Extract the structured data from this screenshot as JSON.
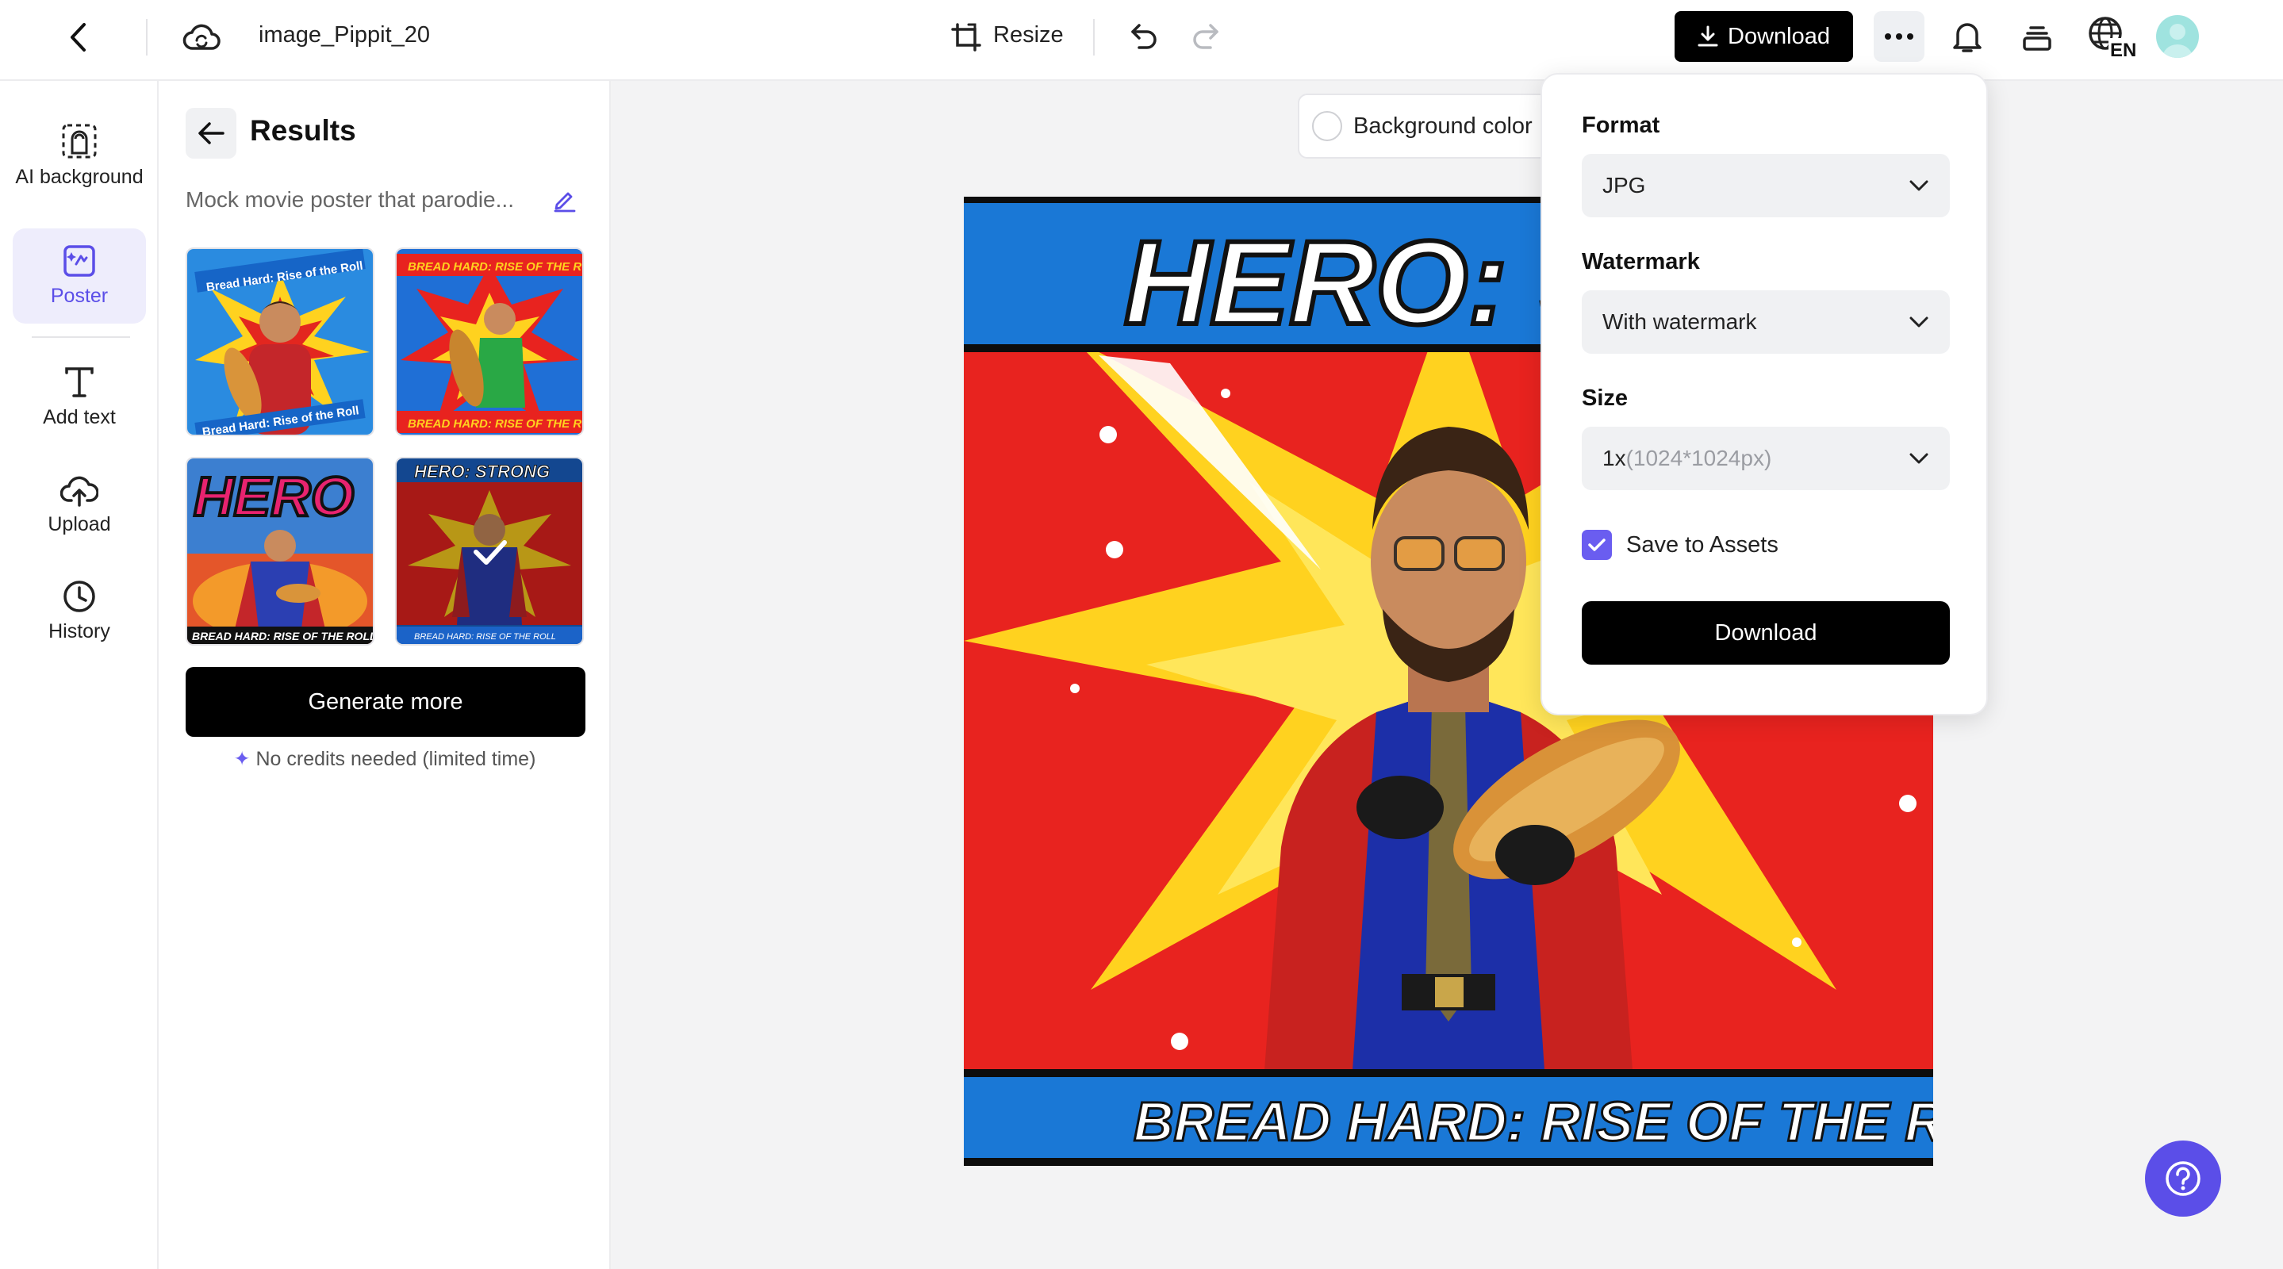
{
  "header": {
    "project_title": "image_Pippit_20",
    "resize_label": "Resize",
    "download_label": "Download",
    "language_label": "EN"
  },
  "sidebar": {
    "items": [
      {
        "label": "AI background",
        "icon": "ai-background-icon",
        "active": false
      },
      {
        "label": "Poster",
        "icon": "poster-icon",
        "active": true
      },
      {
        "label": "Add text",
        "icon": "text-icon",
        "active": false
      },
      {
        "label": "Upload",
        "icon": "upload-icon",
        "active": false
      },
      {
        "label": "History",
        "icon": "history-icon",
        "active": false
      }
    ]
  },
  "results_panel": {
    "title": "Results",
    "prompt_preview": "Mock movie poster that parodie...",
    "thumbnails": [
      {
        "caption_top": "Bread Hard: Rise of the Roll",
        "caption_bottom": "Bread Hard: Rise of the Roll",
        "selected": false
      },
      {
        "caption_top": "BREAD HARD: RISE OF THE ROLL",
        "caption_bottom": "BREAD HARD: RISE OF THE ROLL",
        "selected": false
      },
      {
        "caption_top": "HERO",
        "caption_bottom": "BREAD HARD: RISE OF THE ROLL",
        "selected": false
      },
      {
        "caption_top": "HERO: STRONG",
        "caption_bottom": "BREAD HARD: RISE OF THE ROLL",
        "selected": true
      }
    ],
    "generate_more_label": "Generate more",
    "credits_note": "No credits needed (limited time)"
  },
  "canvas": {
    "background_color_label": "Background color",
    "poster_title": "HERO: STI",
    "poster_subtitle": "BREAD HARD: RISE OF THE ROLL"
  },
  "download_menu": {
    "format_label": "Format",
    "format_value": "JPG",
    "watermark_label": "Watermark",
    "watermark_value": "With watermark",
    "size_label": "Size",
    "size_value_main": "1x",
    "size_value_detail": "(1024*1024px)",
    "save_to_assets_label": "Save to Assets",
    "save_to_assets_checked": true,
    "download_label": "Download"
  },
  "colors": {
    "accent": "#5b4ee8",
    "primary_button": "#000000"
  }
}
